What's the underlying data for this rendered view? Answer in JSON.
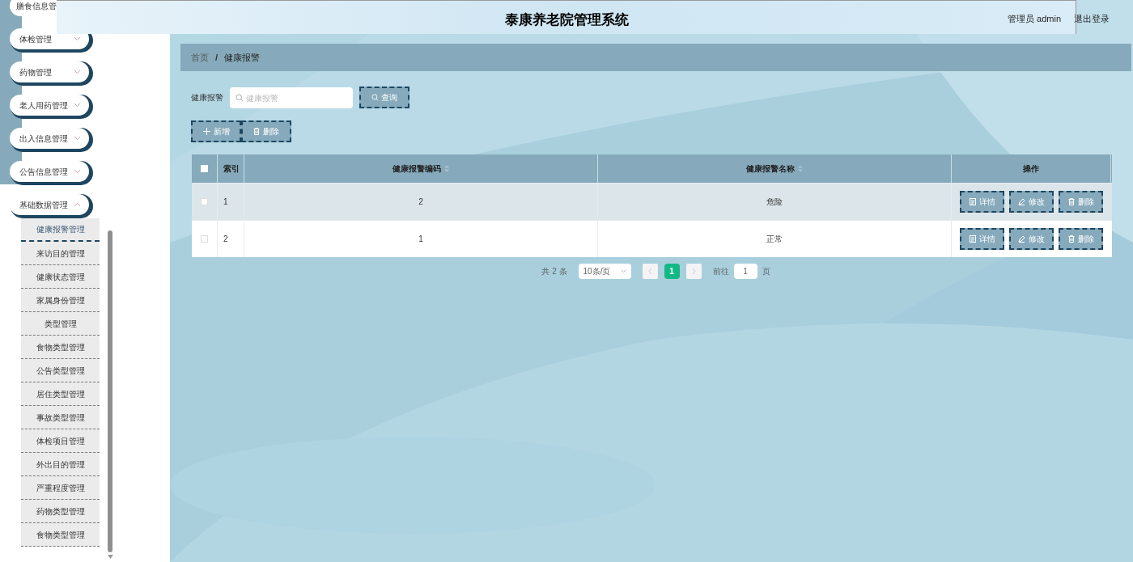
{
  "header": {
    "title": "泰康养老院管理系统",
    "user": "管理员 admin",
    "logout": "退出登录"
  },
  "sidebar": {
    "menus": [
      {
        "label": "膳食信息管",
        "expanded": false,
        "cut": true
      },
      {
        "label": "体检管理",
        "expanded": false,
        "cut": false
      },
      {
        "label": "药物管理",
        "expanded": false,
        "cut": false
      },
      {
        "label": "老人用药管理",
        "expanded": false,
        "cut": false
      },
      {
        "label": "出入信息管理",
        "expanded": false,
        "cut": false
      },
      {
        "label": "公告信息管理",
        "expanded": false,
        "cut": false
      },
      {
        "label": "基础数据管理",
        "expanded": true,
        "cut": false,
        "children": [
          {
            "label": "健康报警管理",
            "selected": true
          },
          {
            "label": "来访目的管理",
            "selected": false
          },
          {
            "label": "健康状态管理",
            "selected": false
          },
          {
            "label": "家属身份管理",
            "selected": false
          },
          {
            "label": "类型管理",
            "selected": false
          },
          {
            "label": "食物类型管理",
            "selected": false
          },
          {
            "label": "公告类型管理",
            "selected": false
          },
          {
            "label": "居住类型管理",
            "selected": false
          },
          {
            "label": "事故类型管理",
            "selected": false
          },
          {
            "label": "体检项目管理",
            "selected": false
          },
          {
            "label": "外出目的管理",
            "selected": false
          },
          {
            "label": "严重程度管理",
            "selected": false
          },
          {
            "label": "药物类型管理",
            "selected": false
          },
          {
            "label": "食物类型管理",
            "selected": false
          }
        ]
      }
    ]
  },
  "breadcrumb": {
    "separator": "/",
    "items": [
      "首页",
      "健康报警"
    ]
  },
  "search": {
    "label": "健康报警",
    "placeholder": "健康报警",
    "button": "查询"
  },
  "actions": [
    "新增",
    "删除"
  ],
  "table": {
    "columns": [
      {
        "label": "索引",
        "sortable": false
      },
      {
        "label": "健康报警编码",
        "sortable": true
      },
      {
        "label": "健康报警名称",
        "sortable": true
      },
      {
        "label": "操作",
        "sortable": false
      }
    ],
    "all_checked": false,
    "rows": [
      {
        "checked": false,
        "highlighted": true,
        "cells": [
          "1",
          "2",
          "危险"
        ],
        "ops": [
          "详情",
          "修改",
          "删除"
        ]
      },
      {
        "checked": false,
        "highlighted": false,
        "cells": [
          "2",
          "1",
          "正常"
        ],
        "ops": [
          "详情",
          "修改",
          "删除"
        ]
      }
    ]
  },
  "pagination": {
    "total": "共 2 条",
    "page_size": "10条/页",
    "pages": [
      {
        "label": "1",
        "selected": true
      }
    ],
    "goto_label": "前往",
    "goto_value": "1",
    "goto_suffix": "页"
  }
}
